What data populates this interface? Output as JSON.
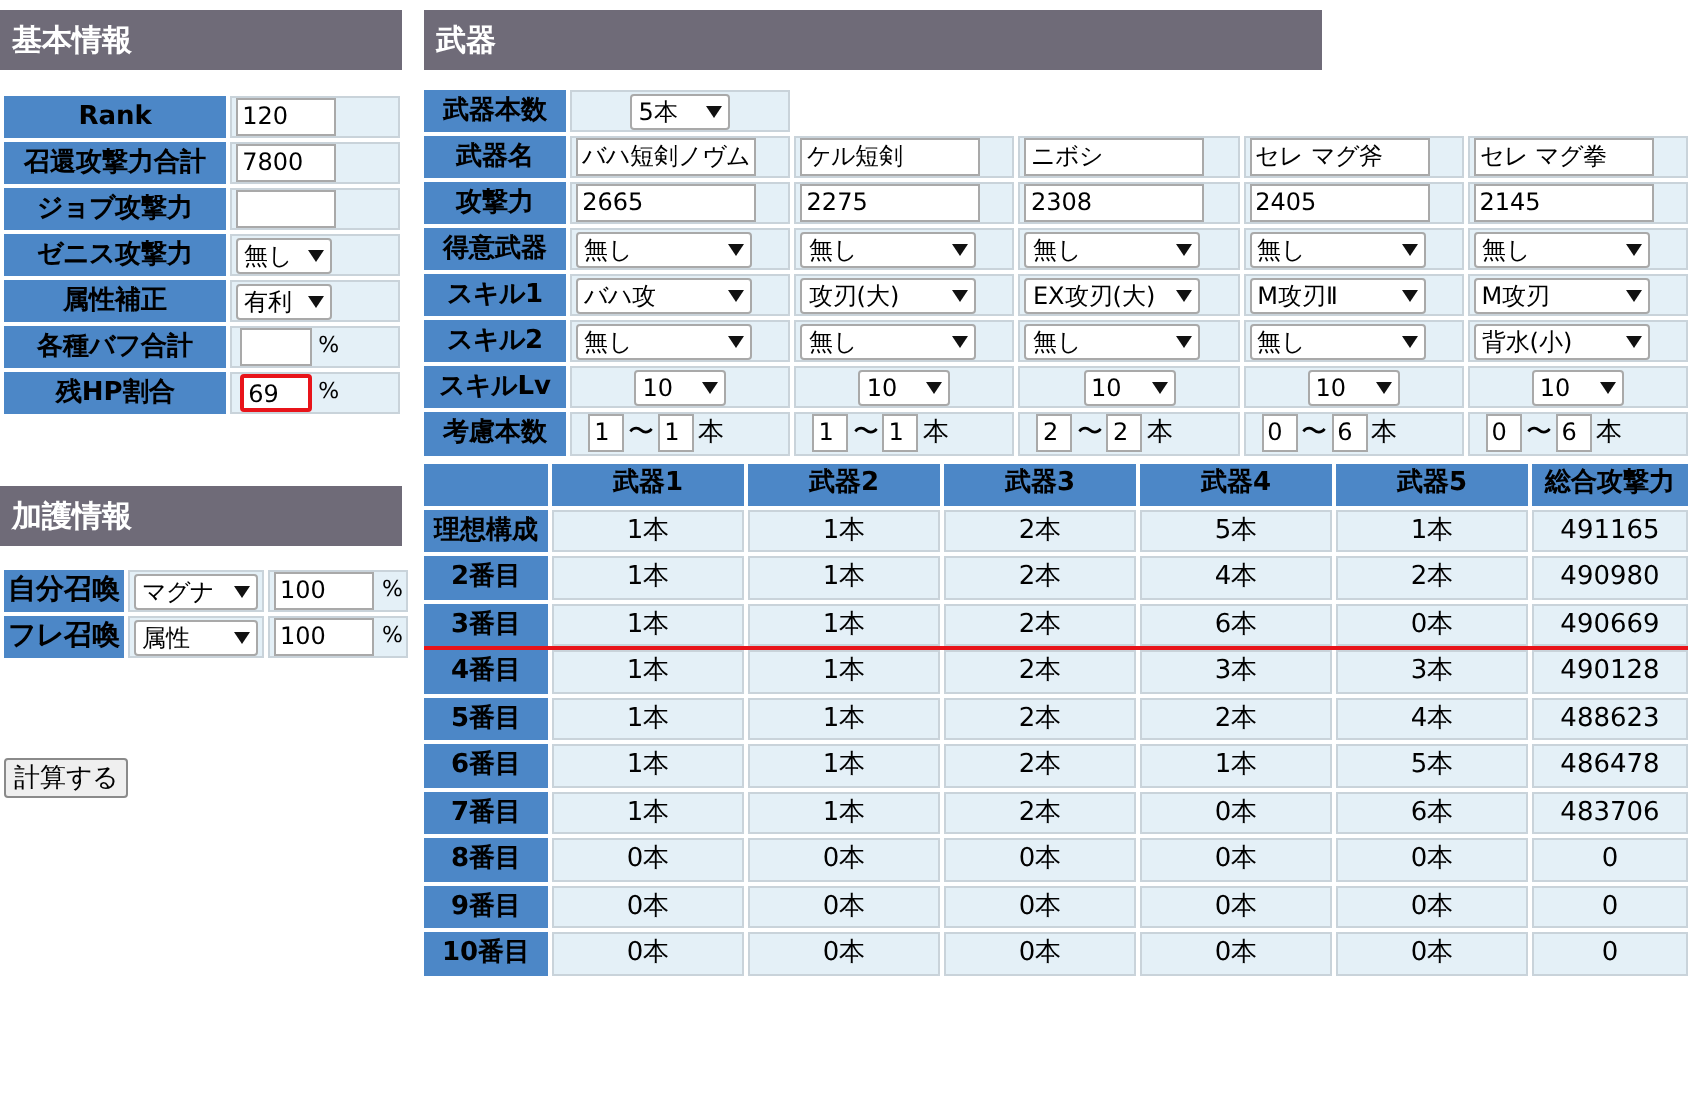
{
  "basic": {
    "title": "基本情報",
    "rows": [
      {
        "label": "Rank",
        "kind": "input",
        "value": "120"
      },
      {
        "label": "召還攻撃力合計",
        "kind": "input",
        "value": "7800"
      },
      {
        "label": "ジョブ攻撃力",
        "kind": "input",
        "value": ""
      },
      {
        "label": "ゼニス攻撃力",
        "kind": "select",
        "value": "無し"
      },
      {
        "label": "属性補正",
        "kind": "select",
        "value": "有利"
      },
      {
        "label": "各種バフ合計",
        "kind": "percent",
        "value": "",
        "unit": "%",
        "highlighted": false
      },
      {
        "label": "残HP割合",
        "kind": "percent",
        "value": "69",
        "unit": "%",
        "highlighted": true
      }
    ]
  },
  "protection": {
    "title": "加護情報",
    "rows": [
      {
        "label": "自分召喚",
        "type": "マグナ",
        "amount": "100",
        "unit": "%"
      },
      {
        "label": "フレ召喚",
        "type": "属性",
        "amount": "100",
        "unit": "%"
      }
    ]
  },
  "calculate_button": "計算する",
  "weapons": {
    "title": "武器",
    "count": {
      "label": "武器本数",
      "value": "5本"
    },
    "rows": [
      {
        "label": "武器名",
        "kind": "text",
        "values": [
          "バハ短剣ノヴム",
          "ケル短剣",
          "ニボシ",
          "セレ マグ斧",
          "セレ マグ拳"
        ]
      },
      {
        "label": "攻撃力",
        "kind": "text",
        "values": [
          "2665",
          "2275",
          "2308",
          "2405",
          "2145"
        ]
      },
      {
        "label": "得意武器",
        "kind": "select",
        "values": [
          "無し",
          "無し",
          "無し",
          "無し",
          "無し"
        ]
      },
      {
        "label": "スキル1",
        "kind": "select",
        "values": [
          "バハ攻",
          "攻刃(大)",
          "EX攻刃(大)",
          "M攻刃Ⅱ",
          "M攻刃"
        ]
      },
      {
        "label": "スキル2",
        "kind": "select",
        "values": [
          "無し",
          "無し",
          "無し",
          "無し",
          "背水(小)"
        ]
      },
      {
        "label": "スキルLv",
        "kind": "level",
        "values": [
          "10",
          "10",
          "10",
          "10",
          "10"
        ]
      },
      {
        "label": "考慮本数",
        "kind": "range",
        "ranges": [
          {
            "from": "1",
            "sep": "〜",
            "to": "1",
            "unit": "本"
          },
          {
            "from": "1",
            "sep": "〜",
            "to": "1",
            "unit": "本"
          },
          {
            "from": "2",
            "sep": "〜",
            "to": "2",
            "unit": "本"
          },
          {
            "from": "0",
            "sep": "〜",
            "to": "6",
            "unit": "本"
          },
          {
            "from": "0",
            "sep": "〜",
            "to": "6",
            "unit": "本"
          }
        ]
      }
    ]
  },
  "results": {
    "columns": [
      "武器1",
      "武器2",
      "武器3",
      "武器4",
      "武器5",
      "総合攻撃力"
    ],
    "rows": [
      {
        "label": "理想構成",
        "cells": [
          "1本",
          "1本",
          "2本",
          "5本",
          "1本",
          "491165"
        ],
        "underlined": false
      },
      {
        "label": "2番目",
        "cells": [
          "1本",
          "1本",
          "2本",
          "4本",
          "2本",
          "490980"
        ],
        "underlined": false
      },
      {
        "label": "3番目",
        "cells": [
          "1本",
          "1本",
          "2本",
          "6本",
          "0本",
          "490669"
        ],
        "underlined": true
      },
      {
        "label": "4番目",
        "cells": [
          "1本",
          "1本",
          "2本",
          "3本",
          "3本",
          "490128"
        ],
        "underlined": false
      },
      {
        "label": "5番目",
        "cells": [
          "1本",
          "1本",
          "2本",
          "2本",
          "4本",
          "488623"
        ],
        "underlined": false
      },
      {
        "label": "6番目",
        "cells": [
          "1本",
          "1本",
          "2本",
          "1本",
          "5本",
          "486478"
        ],
        "underlined": false
      },
      {
        "label": "7番目",
        "cells": [
          "1本",
          "1本",
          "2本",
          "0本",
          "6本",
          "483706"
        ],
        "underlined": false
      },
      {
        "label": "8番目",
        "cells": [
          "0本",
          "0本",
          "0本",
          "0本",
          "0本",
          "0"
        ],
        "underlined": false
      },
      {
        "label": "9番目",
        "cells": [
          "0本",
          "0本",
          "0本",
          "0本",
          "0本",
          "0"
        ],
        "underlined": false
      },
      {
        "label": "10番目",
        "cells": [
          "0本",
          "0本",
          "0本",
          "0本",
          "0本",
          "0"
        ],
        "underlined": false
      }
    ]
  }
}
